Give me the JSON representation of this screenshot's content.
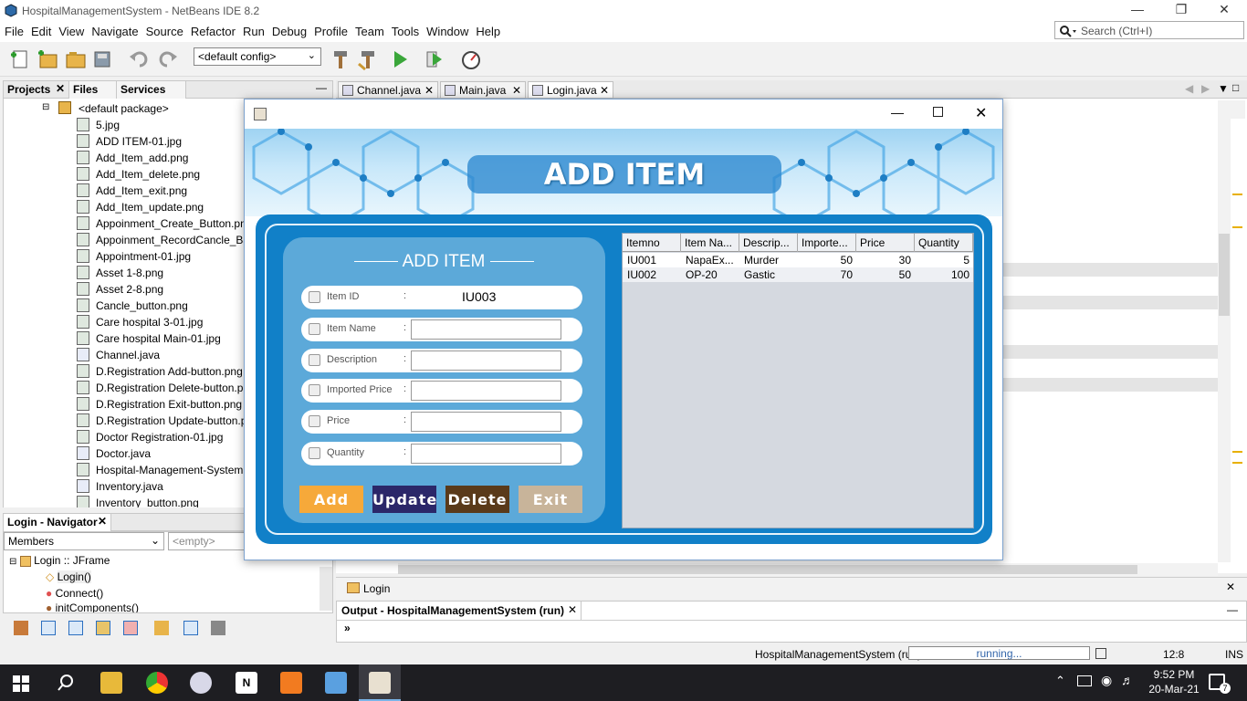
{
  "window": {
    "title": "HospitalManagementSystem - NetBeans IDE 8.2"
  },
  "menus": [
    "File",
    "Edit",
    "View",
    "Navigate",
    "Source",
    "Refactor",
    "Run",
    "Debug",
    "Profile",
    "Team",
    "Tools",
    "Window",
    "Help"
  ],
  "search": {
    "placeholder": "Search (Ctrl+I)"
  },
  "toolbar": {
    "config": "<default config>"
  },
  "left_tabs": [
    "Projects",
    "Files",
    "Services"
  ],
  "tree": {
    "package": "<default package>",
    "files": [
      "5.jpg",
      "ADD ITEM-01.jpg",
      "Add_Item_add.png",
      "Add_Item_delete.png",
      "Add_Item_exit.png",
      "Add_Item_update.png",
      "Appoinment_Create_Button.png",
      "Appoinment_RecordCancle_Back B",
      "Appointment-01.jpg",
      "Asset 1-8.png",
      "Asset 2-8.png",
      "Cancle_button.png",
      "Care hospital 3-01.jpg",
      "Care hospital Main-01.jpg",
      "Channel.java",
      "D.Registration Add-button.png",
      "D.Registration Delete-button.png",
      "D.Registration Exit-button.png",
      "D.Registration Update-button.png",
      "Doctor Registration-01.jpg",
      "Doctor.java",
      "Hospital-Management-System.png",
      "Inventory.java",
      "Inventory_button.png"
    ]
  },
  "navigator": {
    "tab": "Login - Navigator",
    "filter": "Members",
    "empty": "<empty>",
    "root": "Login :: JFrame",
    "items": [
      "Login()",
      "Connect()",
      "initComponents()"
    ]
  },
  "editor_tabs": [
    "Channel.java",
    "Main.java",
    "Login.java"
  ],
  "breadcrumb": "Login",
  "output": {
    "title": "Output - HospitalManagementSystem (run)",
    "prompt": "»"
  },
  "status": {
    "project": "HospitalManagementSystem (run)",
    "progress": "running...",
    "position": "12:8",
    "mode": "INS"
  },
  "taskbar": {
    "time": "9:52 PM",
    "date": "20-Mar-21",
    "notifications": "7"
  },
  "dialog": {
    "banner": "ADD ITEM",
    "form_title": "ADD ITEM",
    "fields": [
      {
        "label": "Item ID",
        "value": "IU003"
      },
      {
        "label": "Item Name",
        "value": ""
      },
      {
        "label": "Description",
        "value": ""
      },
      {
        "label": "Imported Price",
        "value": ""
      },
      {
        "label": "Price",
        "value": ""
      },
      {
        "label": "Quantity",
        "value": ""
      }
    ],
    "buttons": {
      "add": "Add",
      "update": "Update",
      "delete": "Delete",
      "exit": "Exit"
    },
    "table": {
      "columns": [
        "Itemno",
        "Item Na...",
        "Descrip...",
        "Importe...",
        "Price",
        "Quantity"
      ],
      "rows": [
        [
          "IU001",
          "NapaEx...",
          "Murder",
          "50",
          "30",
          "5"
        ],
        [
          "IU002",
          "OP-20",
          "Gastic",
          "70",
          "50",
          "100"
        ]
      ]
    }
  }
}
